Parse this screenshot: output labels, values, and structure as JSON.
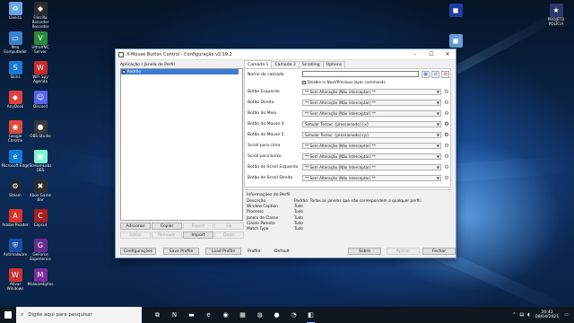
{
  "desktop": {
    "icons": [
      {
        "label": "Lixeira",
        "icon": "recycle-bin-icon",
        "color": "#6aa6e8",
        "glyph": "♻"
      },
      {
        "label": "Filezilla Recorder Recorder",
        "icon": "app-icon",
        "color": "#2c2c2c",
        "glyph": "◆"
      },
      {
        "label": "Meu Computador",
        "icon": "computer-icon",
        "color": "#3b7fd0",
        "glyph": "▭"
      },
      {
        "label": "UltraVNC Server",
        "icon": "vnc-icon",
        "color": "#2a8b3a",
        "glyph": "V"
      },
      {
        "label": "Skins",
        "icon": "app-icon",
        "color": "#1a7ad4",
        "glyph": "S"
      },
      {
        "label": "WiFi Spy Agenda",
        "icon": "app-icon",
        "color": "#c62a2a",
        "glyph": "W"
      },
      {
        "label": "AnyDesk",
        "icon": "anydesk-icon",
        "color": "#e0403a",
        "glyph": "◆"
      },
      {
        "label": "Discord",
        "icon": "discord-icon",
        "color": "#5865f2",
        "glyph": "☺"
      },
      {
        "label": "Google Chrome",
        "icon": "chrome-icon",
        "color": "#dd4b39",
        "glyph": "◉"
      },
      {
        "label": "OBS Studio",
        "icon": "obs-icon",
        "color": "#3a3a3a",
        "glyph": "●"
      },
      {
        "label": "Microsoft Edge",
        "icon": "edge-icon",
        "color": "#0f7bd6",
        "glyph": "e"
      },
      {
        "label": "StreamLabs OBS",
        "icon": "streamlabs-icon",
        "color": "#80f5d2",
        "glyph": "▣"
      },
      {
        "label": "Steam",
        "icon": "steam-icon",
        "color": "#1b2838",
        "glyph": "⚙"
      },
      {
        "label": "Xbox Game Bar",
        "icon": "app-icon",
        "color": "#2e2e2e",
        "glyph": "✖"
      },
      {
        "label": "Adobe Reader",
        "icon": "pdf-icon",
        "color": "#d9352a",
        "glyph": "A"
      },
      {
        "label": "Capcut",
        "icon": "app-icon",
        "color": "#a82020",
        "glyph": "C"
      },
      {
        "label": "Antimalware",
        "icon": "shield-icon",
        "color": "#1a4fa6",
        "glyph": "⛨"
      },
      {
        "label": "GeForce Experience",
        "icon": "app-icon",
        "color": "#6b2c8f",
        "glyph": "G"
      },
      {
        "label": "Ativar Windows",
        "icon": "app-icon",
        "color": "#c33",
        "glyph": "W"
      },
      {
        "label": "Malwarebytes",
        "icon": "app-icon",
        "color": "#7a2f98",
        "glyph": "M"
      }
    ],
    "right_icons": [
      {
        "label": "",
        "icon": "app-icon",
        "color": "#1d3fa0",
        "glyph": "◼"
      },
      {
        "label": "PROJETO POLÍCIA",
        "icon": "logo-icon",
        "color": "#2b3a6b",
        "glyph": "★"
      },
      {
        "label": "",
        "icon": "app-icon",
        "color": "#6aa0d8",
        "glyph": "◼"
      }
    ]
  },
  "window": {
    "title": "X-Mouse Button Control - Configuração v2.19.2",
    "left": {
      "label": "Aplicação / Janela de Perfil",
      "items": [
        {
          "label": "Padrão",
          "checked": true,
          "selected": true
        }
      ]
    },
    "buttons": {
      "adicionar": "Adicionar",
      "copiar": "Copiar",
      "export": "Export",
      "up": "Up",
      "editar": "Editar",
      "remover": "Remover",
      "import": "Import",
      "down": "Down",
      "configuracoes": "Configurações",
      "save_profile": "Save Profile",
      "load_profile": "Load Profile",
      "sobre": "Sobre",
      "aplicar": "Aplicar",
      "fechar": "Fechar"
    },
    "tabs": [
      "Camada 1",
      "Camada 2",
      "Scrolling",
      "Options"
    ],
    "layer": {
      "name_label": "Nome da camada",
      "name_value": "",
      "disable_label": "Disable in Next/Previous layer commands"
    },
    "mappings": [
      {
        "label": "Botão Esquerdo",
        "value": "** Sem Alteração (Não interceptar) **",
        "gear": false
      },
      {
        "label": "Botão Direito",
        "value": "** Sem Alteração (Não interceptar) **",
        "gear": false
      },
      {
        "label": "Botão do Meio",
        "value": "** Sem Alteração (Não interceptar) **",
        "gear": false
      },
      {
        "label": "Botão do Mouse 4",
        "value": "Simular Teclas: {pressionado}{x}",
        "gear": true
      },
      {
        "label": "Botão do Mouse 5",
        "value": "Simular Teclas: {pressionado}{p}",
        "gear": true
      },
      {
        "label": "Scroll para cima",
        "value": "** Sem Alteração (Não interceptar) **",
        "gear": false
      },
      {
        "label": "Scroll para baixo",
        "value": "** Sem Alteração (Não interceptar) **",
        "gear": false
      },
      {
        "label": "Botão de Scroll Esquerdo",
        "value": "** Sem Alteração (Não interceptar) **",
        "gear": false
      },
      {
        "label": "Botão de Scroll Direito",
        "value": "** Sem Alteração (Não interceptar) **",
        "gear": false
      }
    ],
    "info": {
      "header": "Informações do Perfil",
      "rows": [
        {
          "k": "Descrição",
          "v": "Padrão: Todas as janelas que não correspondem a qualquer perfil."
        },
        {
          "k": "Window Caption",
          "v": "Tudo"
        },
        {
          "k": "Processo",
          "v": "Tudo"
        },
        {
          "k": "Janela de Classe",
          "v": "Tudo"
        },
        {
          "k": "Classe Parente",
          "v": "Tudo"
        },
        {
          "k": "Match Type",
          "v": "Tudo"
        }
      ]
    },
    "profile_label": "Profile:",
    "profile_value": "Default"
  },
  "taskbar": {
    "search_placeholder": "Digite aqui para pesquisar",
    "time": "20:42",
    "date": "08/04/2021",
    "apps": [
      {
        "icon": "task-view-icon",
        "glyph": "⧉",
        "active": false
      },
      {
        "icon": "netflix-icon",
        "glyph": "N",
        "active": false
      },
      {
        "icon": "file-explorer-icon",
        "glyph": "▬",
        "active": false
      },
      {
        "icon": "edge-icon",
        "glyph": "e",
        "active": false
      },
      {
        "icon": "chrome-icon",
        "glyph": "◉",
        "active": false
      },
      {
        "icon": "store-icon",
        "glyph": "▦",
        "active": false
      },
      {
        "icon": "whatsapp-icon",
        "glyph": "◍",
        "active": false
      },
      {
        "icon": "obs-icon",
        "glyph": "●",
        "active": false
      },
      {
        "icon": "clock-app-icon",
        "glyph": "◔",
        "active": false
      },
      {
        "icon": "mouse-app-icon",
        "glyph": "◧",
        "active": true
      }
    ]
  }
}
